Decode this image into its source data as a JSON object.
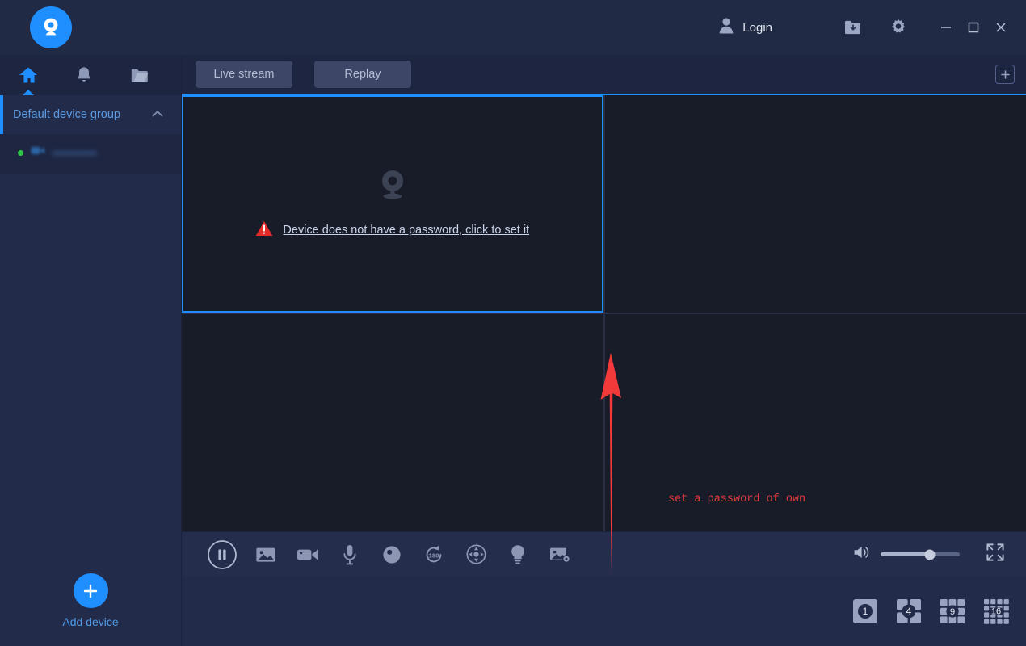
{
  "titlebar": {
    "logo_icon": "webcam-logo-icon",
    "login_label": "Login",
    "user_icon": "user-icon",
    "download_icon": "download-folder-icon",
    "settings_icon": "gear-icon",
    "minimize_icon": "minimize-icon",
    "maximize_icon": "maximize-icon",
    "close_icon": "close-icon"
  },
  "sidebar": {
    "nav": [
      {
        "name": "home",
        "icon": "home-icon",
        "active": true
      },
      {
        "name": "alerts",
        "icon": "bell-icon",
        "active": false
      },
      {
        "name": "files",
        "icon": "folder-icon",
        "active": false
      }
    ],
    "group": {
      "label": "Default device group",
      "collapse_icon": "chevron-up-icon",
      "expanded": true
    },
    "devices": [
      {
        "status": "online",
        "status_color": "#2ec94a",
        "icon": "camera-icon",
        "name": "••••••••••••",
        "redacted": true
      }
    ],
    "add_device": {
      "label": "Add device",
      "icon": "plus-icon"
    }
  },
  "tabbar": {
    "tabs": [
      {
        "label": "Live stream",
        "active": true
      },
      {
        "label": "Replay",
        "active": false
      }
    ],
    "add_button_icon": "plus-square-icon"
  },
  "video": {
    "selected_cell_index": 0,
    "cells": [
      {
        "placeholder_icon": "webcam-placeholder-icon",
        "warning_icon": "warning-triangle-icon",
        "warning_text": "Device does not have a password, click to set it",
        "has_message": true
      },
      {
        "has_message": false
      },
      {
        "has_message": false
      },
      {
        "has_message": false
      }
    ]
  },
  "annotation": {
    "arrow": "red-up-arrow",
    "text": "set a password of own",
    "color": "#e03a3a"
  },
  "controls": [
    {
      "name": "pause-button",
      "icon": "pause-icon"
    },
    {
      "name": "snapshot-button",
      "icon": "image-icon"
    },
    {
      "name": "record-video-button",
      "icon": "video-camera-icon"
    },
    {
      "name": "microphone-button",
      "icon": "microphone-icon"
    },
    {
      "name": "record-button",
      "icon": "record-dot-icon"
    },
    {
      "name": "rotate-180-button",
      "icon": "rotate-180-icon"
    },
    {
      "name": "ptz-button",
      "icon": "ptz-direction-icon"
    },
    {
      "name": "light-button",
      "icon": "lightbulb-icon"
    },
    {
      "name": "image-settings-button",
      "icon": "image-settings-icon"
    }
  ],
  "control_right": {
    "volume_icon": "volume-icon",
    "volume_percent": 62,
    "fullscreen_icon": "fullscreen-icon"
  },
  "layouts": [
    {
      "label": "1",
      "name": "layout-1",
      "active": true
    },
    {
      "label": "4",
      "name": "layout-4",
      "active": false
    },
    {
      "label": "9",
      "name": "layout-9",
      "active": false
    },
    {
      "label": "16",
      "name": "layout-16",
      "active": false
    }
  ],
  "colors": {
    "accent": "#1f8fff",
    "window_bg": "#222a47",
    "panel_bg": "#181c28",
    "warning": "#e52a2a",
    "online": "#2ec94a"
  }
}
